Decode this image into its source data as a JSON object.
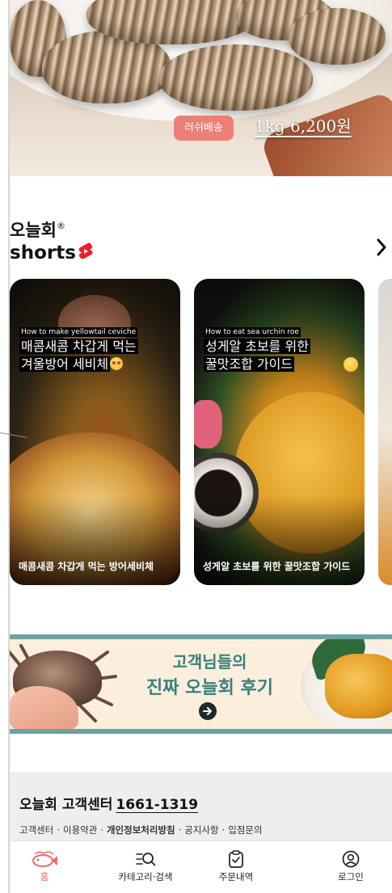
{
  "hero": {
    "badge": "러쉬배송",
    "price": "1kg 6,200원"
  },
  "shorts": {
    "brand": "오늘회",
    "brand_mark": "®",
    "title": "shorts",
    "cards": [
      {
        "en": "How to make yellowtail ceviche",
        "title_line1": "매콤새콤 차갑게 먹는",
        "title_line2": "겨울방어 세비체",
        "caption": "매콤새콤 차갑게 먹는 방어세비체"
      },
      {
        "en": "How to eat sea urchin roe",
        "title_line1": "성게알 초보를 위한",
        "title_line2": "꿀맛조합 가이드",
        "caption": "성게알 초보를 위한 꿀맛조합 가이드"
      }
    ]
  },
  "banner": {
    "line1": "고객님들의",
    "line2": "진짜 오늘회 후기"
  },
  "customer_center": {
    "title": "오늘회 고객센터",
    "phone": "1661-1319",
    "links": [
      "고객센터",
      "이용약관",
      "개인정보처리방침",
      "공지사항",
      "입점문의"
    ],
    "separator": "·"
  },
  "tabbar": {
    "home": "홈",
    "category_search": "카테고리·검색",
    "orders": "주문내역",
    "login": "로그인"
  },
  "colors": {
    "accent": "#ee7f76",
    "banner_teal": "#37807d"
  }
}
